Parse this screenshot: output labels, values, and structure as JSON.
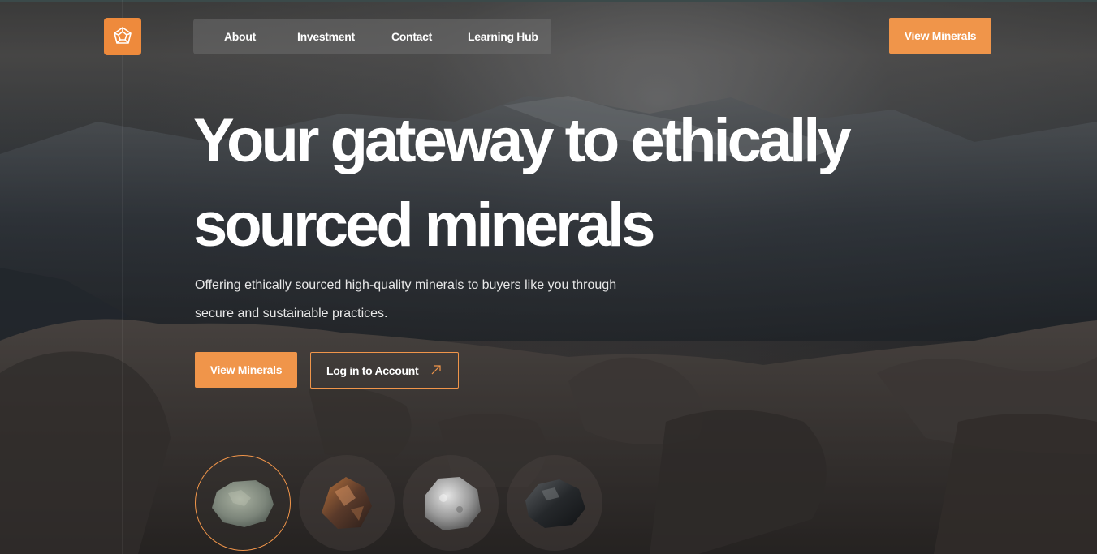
{
  "brand": {
    "logo_icon": "dodecahedron-icon",
    "accent_color": "#f0954a"
  },
  "nav": {
    "items": [
      {
        "label": "About"
      },
      {
        "label": "Investment"
      },
      {
        "label": "Contact"
      },
      {
        "label": "Learning Hub"
      }
    ]
  },
  "header": {
    "cta_label": "View Minerals"
  },
  "hero": {
    "headline_line1": "Your gateway to ethically",
    "headline_line2": "sourced minerals",
    "subtitle_line1": "Offering ethically sourced high-quality minerals to buyers like you through",
    "subtitle_line2": "secure and sustainable practices.",
    "primary_cta": "View Minerals",
    "secondary_cta": "Log in to Account",
    "secondary_cta_icon": "arrow-up-right-icon"
  },
  "minerals": [
    {
      "name": "green-gray-stone",
      "selected": true
    },
    {
      "name": "bronze-ore",
      "selected": false
    },
    {
      "name": "silver-ore",
      "selected": false
    },
    {
      "name": "black-ore",
      "selected": false
    }
  ]
}
